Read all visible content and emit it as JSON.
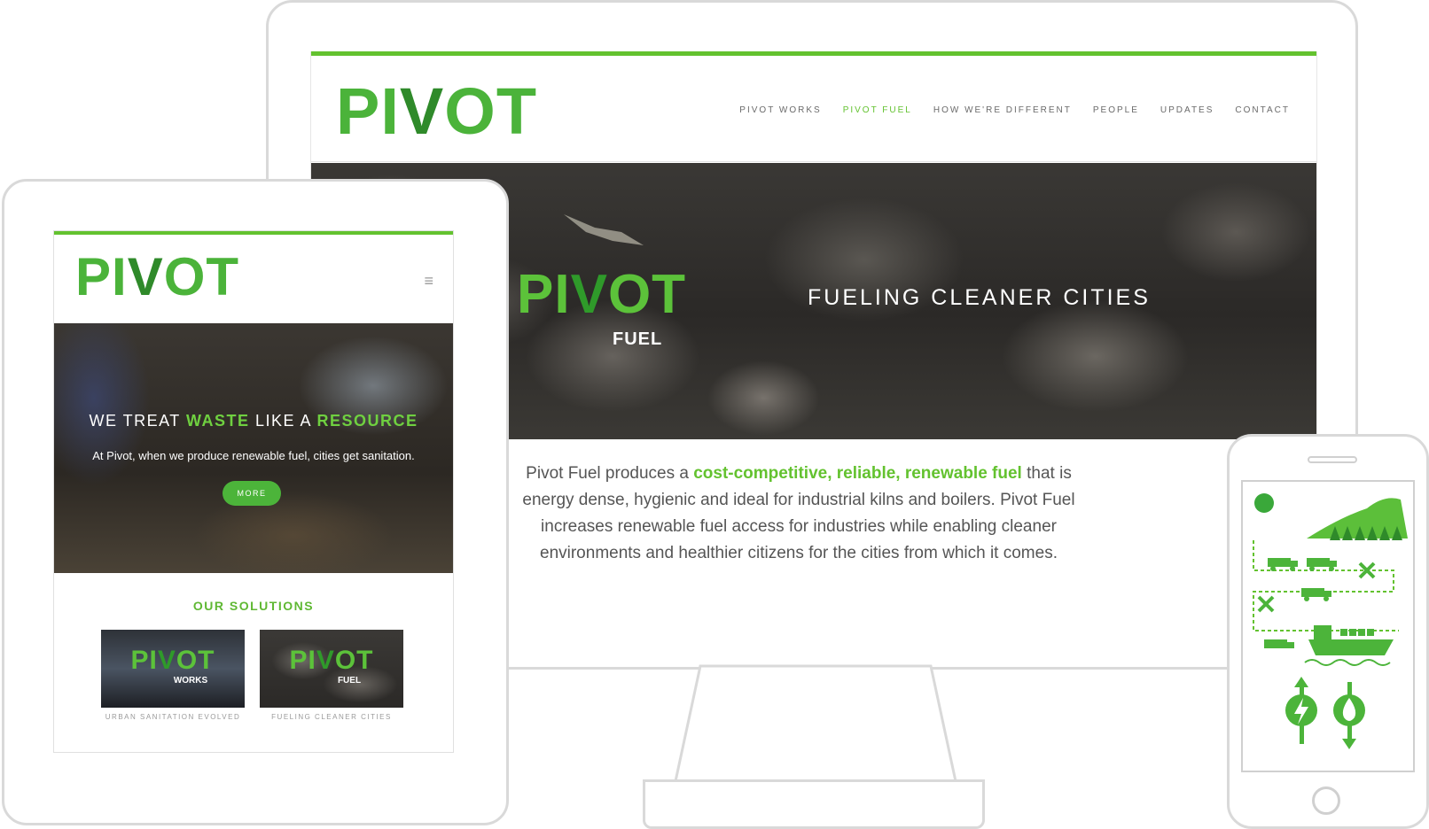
{
  "brand": {
    "green": "#63c22f",
    "dark_green": "#2f8a2a",
    "frame_gray": "#d9d9d9"
  },
  "desktop": {
    "logo": {
      "pi": "PI",
      "v": "V",
      "ot": "OT"
    },
    "nav": [
      "PIVOT WORKS",
      "PIVOT FUEL",
      "HOW WE'RE DIFFERENT",
      "PEOPLE",
      "UPDATES",
      "CONTACT"
    ],
    "active_nav": "PIVOT FUEL",
    "hero": {
      "logo": {
        "pi": "PI",
        "v": "V",
        "ot": "OT"
      },
      "logo_sub": "FUEL",
      "tagline": "FUELING CLEANER CITIES"
    },
    "body": {
      "lead": "Pivot Fuel produces a ",
      "highlight": "cost-competitive, reliable, renewable fuel",
      "rest": " that is energy dense, hygienic and ideal for industrial kilns and boilers. Pivot Fuel increases renewable fuel access for industries while enabling cleaner environments and healthier citizens for the cities from which it comes."
    }
  },
  "tablet": {
    "logo": {
      "pi": "PI",
      "v": "V",
      "ot": "OT"
    },
    "menu_icon": "hamburger-icon",
    "hero": {
      "headline": {
        "part1": "WE TREAT ",
        "waste": "WASTE",
        "part2": " LIKE A ",
        "resource": "RESOURCE"
      },
      "intro": "At Pivot, when we produce renewable fuel, cities get sanitation.",
      "more_button": "MORE"
    },
    "solutions": {
      "title": "OUR SOLUTIONS",
      "items": [
        {
          "logo": {
            "pi": "PI",
            "v": "V",
            "ot": "OT"
          },
          "sub": "WORKS",
          "caption": "URBAN SANITATION EVOLVED"
        },
        {
          "logo": {
            "pi": "PI",
            "v": "V",
            "ot": "OT"
          },
          "sub": "FUEL",
          "caption": "FUELING CLEANER CITIES"
        }
      ]
    }
  },
  "phone": {
    "icons": [
      "sun-icon",
      "mountain-icon",
      "tree-icon",
      "truck-icon",
      "x-icon",
      "ship-icon",
      "lightning-icon",
      "water-drop-icon"
    ]
  }
}
